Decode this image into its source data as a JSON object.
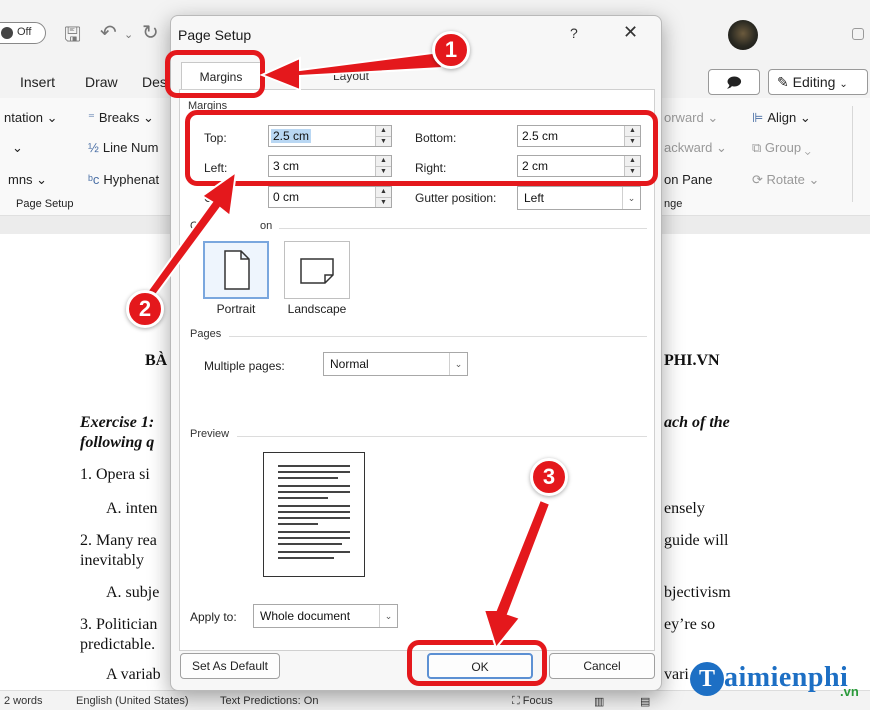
{
  "word": {
    "toggle_label": "Off",
    "menu": [
      "Insert",
      "Draw",
      "Des"
    ],
    "comment_icon": "comment-icon",
    "editing_label": "Editing",
    "ribbon": {
      "orientation": "ntation",
      "breaks": "Breaks",
      "line_numbers": "Line Num",
      "columns": "mns",
      "hyphenation": "Hyphenat",
      "group_label": "Page Setup",
      "forward": "orward",
      "backward": "ackward",
      "selection_pane": "on Pane",
      "arrange": "nge",
      "align": "Align",
      "group": "Group",
      "rotate": "Rotate"
    },
    "doc": {
      "heading_left": "BÀ",
      "heading_right": "PHI.VN",
      "exercise": "Exercise 1:",
      "exercise_right": "ach of the",
      "following": "following q",
      "line1": "1.   Opera si",
      "line2a": "A. inten",
      "line2b": "ensely",
      "line3a": "2. Many rea",
      "line3b": "guide will",
      "line4": "inevitably",
      "line5a": "A. subje",
      "line5b": "bjectivism",
      "line6a": "3. Politician",
      "line6b": "ey’re so",
      "line7": "predictable.",
      "line8a": "A variab",
      "line8b": "vari"
    },
    "status": {
      "words": "2 words",
      "language": "English (United States)",
      "predictions": "Text Predictions: On",
      "focus": "Focus"
    },
    "logo": {
      "letter": "T",
      "text": "aimienphi",
      "suffix": ".vn"
    }
  },
  "dialog": {
    "title": "Page Setup",
    "help": "?",
    "close": "✕",
    "tabs": {
      "margins": "Margins",
      "layout": "Layout"
    },
    "margins_group": "Margins",
    "top_label": "Top:",
    "top_value": "2.5 cm",
    "bottom_label": "Bottom:",
    "bottom_value": "2.5 cm",
    "left_label": "Left:",
    "left_value": "3 cm",
    "right_label": "Right:",
    "right_value": "2 cm",
    "gutter_label": "Gu",
    "gutter_value": "0 cm",
    "gutter_pos_label": "Gutter position:",
    "gutter_pos_value": "Left",
    "orientation_group_a": "O",
    "orientation_group_b": "on",
    "portrait": "Portrait",
    "landscape": "Landscape",
    "pages_group": "Pages",
    "multiple_pages_label": "Multiple pages:",
    "multiple_pages_value": "Normal",
    "preview_group": "Preview",
    "apply_label": "Apply to:",
    "apply_value": "Whole document",
    "set_default": "Set As Default",
    "ok": "OK",
    "cancel": "Cancel"
  },
  "annotations": {
    "badge1": "1",
    "badge2": "2",
    "badge3": "3",
    "color": "#e4181c"
  }
}
